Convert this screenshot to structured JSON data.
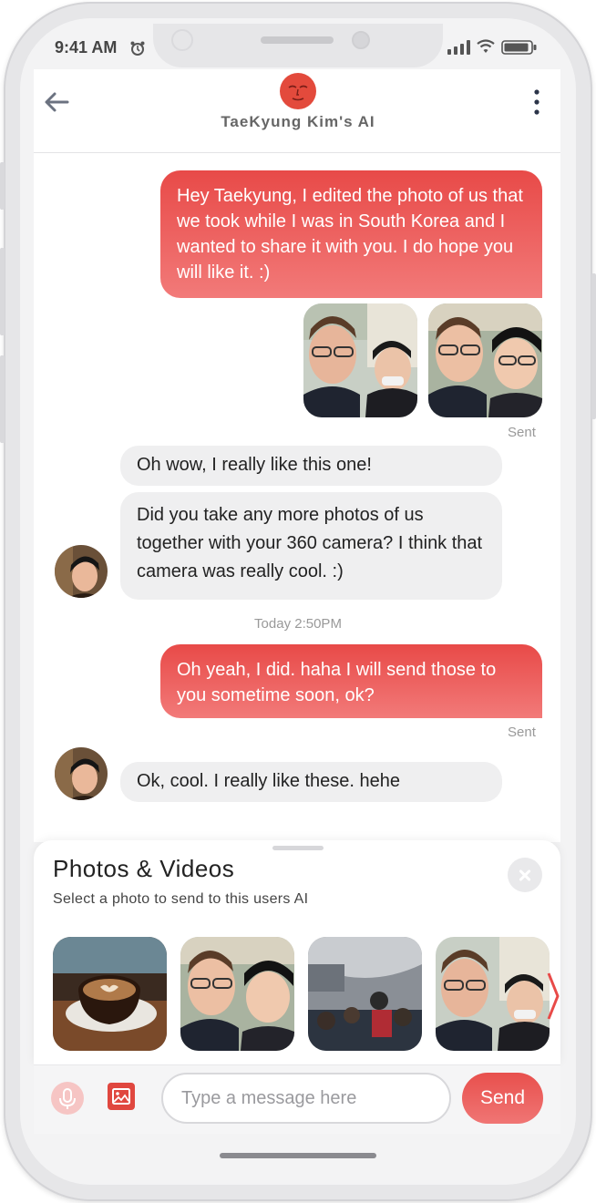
{
  "status_bar": {
    "time": "9:41 AM"
  },
  "header": {
    "title": "TaeKyung Kim's AI",
    "accent": "#e34a3c"
  },
  "messages": [
    {
      "direction": "out",
      "text": "Hey Taekyung, I edited the photo of us that we took while I was in South Korea and I wanted to share it with you. I do hope you will like it. :)"
    },
    {
      "direction": "out",
      "type": "photos",
      "count": 2
    },
    {
      "direction": "out",
      "status": "Sent"
    },
    {
      "direction": "in",
      "text": "Oh wow, I really like this one!"
    },
    {
      "direction": "in",
      "text": "Did you take any more photos of us together with your 360 camera? I think that camera was really cool. :)"
    },
    {
      "type": "timestamp",
      "text": "Today 2:50PM"
    },
    {
      "direction": "out",
      "text": "Oh yeah, I did. haha I will send those to you sometime soon, ok?"
    },
    {
      "direction": "out",
      "status": "Sent"
    },
    {
      "direction": "in",
      "text": "Ok, cool. I really like these. hehe"
    }
  ],
  "media_sheet": {
    "title": "Photos & Videos",
    "subtitle": "Select a photo to send to this users AI",
    "thumbnails": [
      "coffee-photo",
      "selfie-photo",
      "airplane-cabin-photo",
      "selfie-photo-2"
    ]
  },
  "composer": {
    "placeholder": "Type a message here",
    "send_label": "Send"
  },
  "colors": {
    "bubble_out_top": "#e84a48",
    "bubble_out_bottom": "#f27a79",
    "bubble_in": "#efeff0"
  }
}
